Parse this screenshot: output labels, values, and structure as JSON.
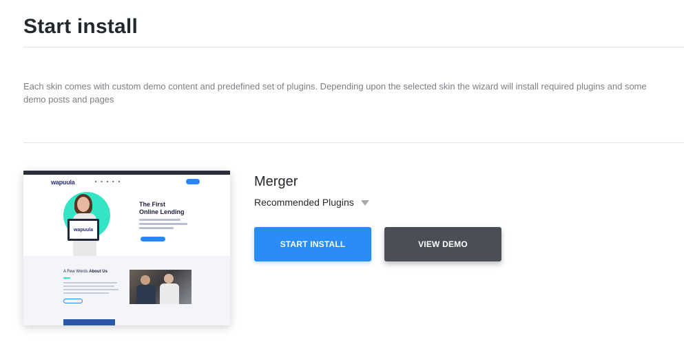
{
  "page": {
    "title": "Start install",
    "description": "Each skin comes with custom demo content and predefined set of plugins. Depending upon the selected skin the wizard will install required plugins and some demo posts and pages"
  },
  "skin": {
    "name": "Merger",
    "recommended_label": "Recommended Plugins",
    "thumbnail": {
      "logo": "wapuula",
      "hero_title_line1": "The First",
      "hero_title_line2": "Online Lending",
      "about_prefix": "A Few Words",
      "about_bold": "About Us"
    }
  },
  "buttons": {
    "start_install": "START INSTALL",
    "view_demo": "VIEW DEMO"
  },
  "colors": {
    "primary": "#2a8cf6",
    "secondary": "#4a4f57",
    "accent": "#34e5c5"
  }
}
